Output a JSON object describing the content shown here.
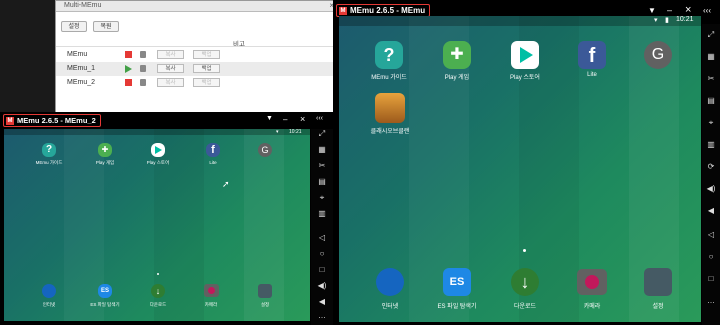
{
  "manager": {
    "title": "Multi-MEmu",
    "toolbar": {
      "settings_label": "설정",
      "restore_label": "복원"
    },
    "header_label": "비고",
    "rows": [
      {
        "name": "MEmu",
        "state": "stopped",
        "copy_label": "복사",
        "backup_label": "백업",
        "enabled": false
      },
      {
        "name": "MEmu_1",
        "state": "running",
        "copy_label": "복사",
        "backup_label": "백업",
        "enabled": true
      },
      {
        "name": "MEmu_2",
        "state": "stopped",
        "copy_label": "복사",
        "backup_label": "백업",
        "enabled": false
      }
    ]
  },
  "window_small": {
    "title": "MEmu 2.6.5 - MEmu_2",
    "time": "10:21",
    "apps": [
      {
        "label": "MEmu 가이드",
        "icon": "help-icon",
        "color": "#26a69a"
      },
      {
        "label": "Play 게임",
        "icon": "gamepad-icon",
        "color": "#4caf50"
      },
      {
        "label": "Play 스토어",
        "icon": "play-store-icon",
        "color": "#ffffff"
      },
      {
        "label": "Lite",
        "icon": "facebook-icon",
        "color": "#3b5998"
      },
      {
        "label": "",
        "icon": "google-settings-icon",
        "color": "#616161"
      }
    ],
    "dock": [
      {
        "label": "인터넷",
        "icon": "globe-icon"
      },
      {
        "label": "ES 파일 탐색기",
        "icon": "es-file-explorer-icon"
      },
      {
        "label": "다운로드",
        "icon": "download-icon"
      },
      {
        "label": "카메라",
        "icon": "camera-icon"
      },
      {
        "label": "설정",
        "icon": "settings-icon"
      }
    ]
  },
  "window_large": {
    "title": "MEmu 2.6.5 - MEmu",
    "time": "10:21",
    "apps": [
      {
        "label": "MEmu 가이드",
        "icon": "help-icon",
        "color": "#26a69a"
      },
      {
        "label": "Play 게임",
        "icon": "gamepad-icon",
        "color": "#4caf50"
      },
      {
        "label": "Play 스토어",
        "icon": "play-store-icon",
        "color": "#ffffff"
      },
      {
        "label": "Lite",
        "icon": "facebook-icon",
        "color": "#3b5998"
      },
      {
        "label": "",
        "icon": "google-settings-icon",
        "color": "#616161"
      },
      {
        "label": "클래시오브클랜",
        "icon": "clash-of-clans-icon",
        "color": "#c0762a"
      }
    ],
    "dock": [
      {
        "label": "인터넷",
        "icon": "globe-icon"
      },
      {
        "label": "ES 파일 탐색기",
        "icon": "es-file-explorer-icon"
      },
      {
        "label": "다운로드",
        "icon": "download-icon"
      },
      {
        "label": "카메라",
        "icon": "camera-icon"
      },
      {
        "label": "설정",
        "icon": "settings-icon"
      }
    ]
  }
}
